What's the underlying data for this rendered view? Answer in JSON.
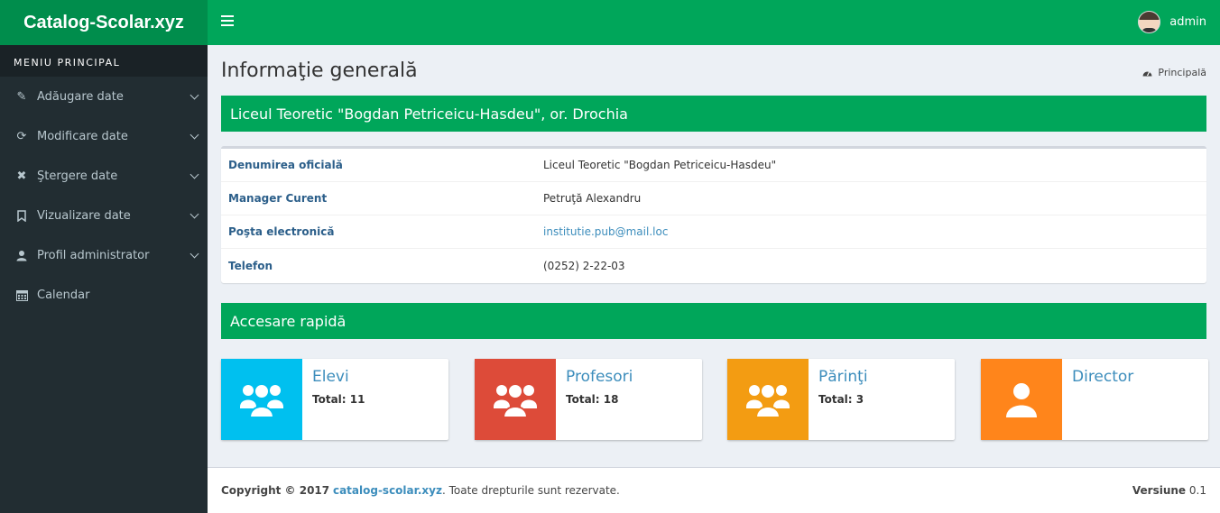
{
  "header": {
    "logo": "Catalog-Scolar.xyz",
    "username": "admin"
  },
  "sidebar": {
    "title": "MENIU PRINCIPAL",
    "items": [
      {
        "label": "Adăugare date",
        "icon": "pencil-icon",
        "glyph": "✎"
      },
      {
        "label": "Modificare date",
        "icon": "refresh-icon",
        "glyph": "⟳"
      },
      {
        "label": "Ştergere date",
        "icon": "times-icon",
        "glyph": "✖"
      },
      {
        "label": "Vizualizare date",
        "icon": "bookmark-icon",
        "glyph": "⌑"
      },
      {
        "label": "Profil administrator",
        "icon": "user-icon",
        "glyph": "●"
      },
      {
        "label": "Calendar",
        "icon": "calendar-icon",
        "glyph": "▦"
      }
    ]
  },
  "main": {
    "title": "Informaţie generală",
    "breadcrumb": "Principală",
    "school_name": "Liceul Teoretic \"Bogdan Petriceicu-Hasdeu\",  or. Drochia",
    "info": [
      {
        "label": "Denumirea oficială",
        "value": "Liceul Teoretic \"Bogdan Petriceicu-Hasdeu\""
      },
      {
        "label": "Manager Curent",
        "value": "Petruţă Alexandru"
      },
      {
        "label": "Poşta electronică",
        "value": "institutie.pub@mail.loc"
      },
      {
        "label": "Telefon",
        "value": "(0252) 2-22-03"
      }
    ],
    "quick_access_title": "Accesare rapidă",
    "tiles": [
      {
        "title": "Elevi",
        "total": "Total: 11",
        "color": "#00c0ef"
      },
      {
        "title": "Profesori",
        "total": "Total: 18",
        "color": "#dd4b39"
      },
      {
        "title": "Părinţi",
        "total": "Total: 3",
        "color": "#f39c12"
      },
      {
        "title": "Director",
        "total": "",
        "color": "#ff851b"
      }
    ]
  },
  "footer": {
    "copyright": "Copyright © 2017",
    "site": "catalog-scolar.xyz",
    "rights": ". Toate drepturile sunt rezervate.",
    "version_label": "Versiune",
    "version": "0.1"
  }
}
